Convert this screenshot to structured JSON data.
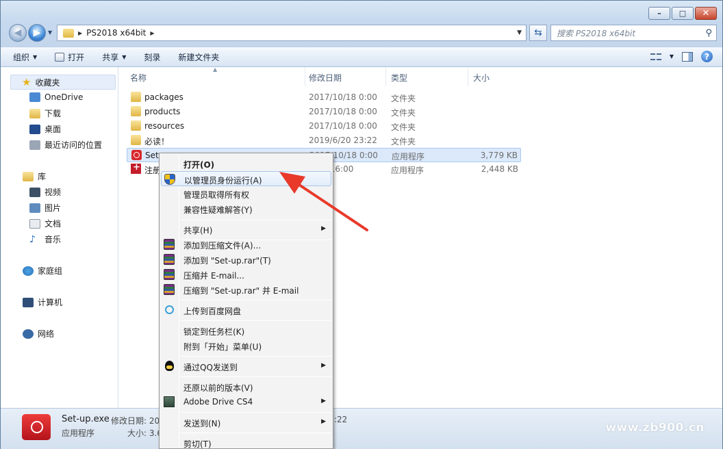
{
  "window": {
    "minimize_glyph": "–",
    "maximize_glyph": "□",
    "close_glyph": "✕"
  },
  "address": {
    "path": "PS2018 x64bit",
    "search_placeholder": "搜索 PS2018 x64bit"
  },
  "toolbar": {
    "organize": "组织",
    "open": "打开",
    "share": "共享",
    "burn": "刻录",
    "new_folder": "新建文件夹"
  },
  "sidebar": {
    "favorites": "收藏夹",
    "onedrive": "OneDrive",
    "downloads": "下载",
    "desktop": "桌面",
    "recent": "最近访问的位置",
    "libraries": "库",
    "videos": "视频",
    "pictures": "图片",
    "documents": "文档",
    "music": "音乐",
    "homegroup": "家庭组",
    "computer": "计算机",
    "network": "网络"
  },
  "columns": {
    "name": "名称",
    "date": "修改日期",
    "type": "类型",
    "size": "大小"
  },
  "files": [
    {
      "name": "packages",
      "date": "2017/10/18 0:00",
      "type": "文件夹",
      "size": ""
    },
    {
      "name": "products",
      "date": "2017/10/18 0:00",
      "type": "文件夹",
      "size": ""
    },
    {
      "name": "resources",
      "date": "2017/10/18 0:00",
      "type": "文件夹",
      "size": ""
    },
    {
      "name": "必读！",
      "date": "2019/6/20 23:22",
      "type": "文件夹",
      "size": ""
    },
    {
      "name": "Set-up.exe",
      "date": "2017/10/18 0:00",
      "type": "应用程序",
      "size": "3,779 KB"
    },
    {
      "name": "注册",
      "date": "11/4 16:00",
      "type": "应用程序",
      "size": "2,448 KB"
    }
  ],
  "context_menu": {
    "open": "打开(O)",
    "run_as_admin": "以管理员身份运行(A)",
    "take_ownership": "管理员取得所有权",
    "compat": "兼容性疑难解答(Y)",
    "share": "共享(H)",
    "add_archive": "添加到压缩文件(A)...",
    "add_rar": "添加到 \"Set-up.rar\"(T)",
    "compress_email": "压缩并 E-mail...",
    "compress_rar_email": "压缩到 \"Set-up.rar\" 并 E-mail",
    "baidu": "上传到百度网盘",
    "pin_taskbar": "锁定到任务栏(K)",
    "pin_start": "附到「开始」菜单(U)",
    "qq": "通过QQ发送到",
    "restore": "还原以前的版本(V)",
    "adobe_drive": "Adobe Drive CS4",
    "send_to": "发送到(N)",
    "cut": "剪切(T)"
  },
  "details": {
    "name": "Set-up.exe",
    "type": "应用程序",
    "modified_label": "修改日期: 20",
    "size_label": "大小: 3.6",
    "tail": ":22"
  },
  "watermark": "www.zb900.cn",
  "colors": {
    "selection": "#dbe9fb",
    "highlight_border": "#a8c6ea",
    "arrow": "#e8392b"
  }
}
